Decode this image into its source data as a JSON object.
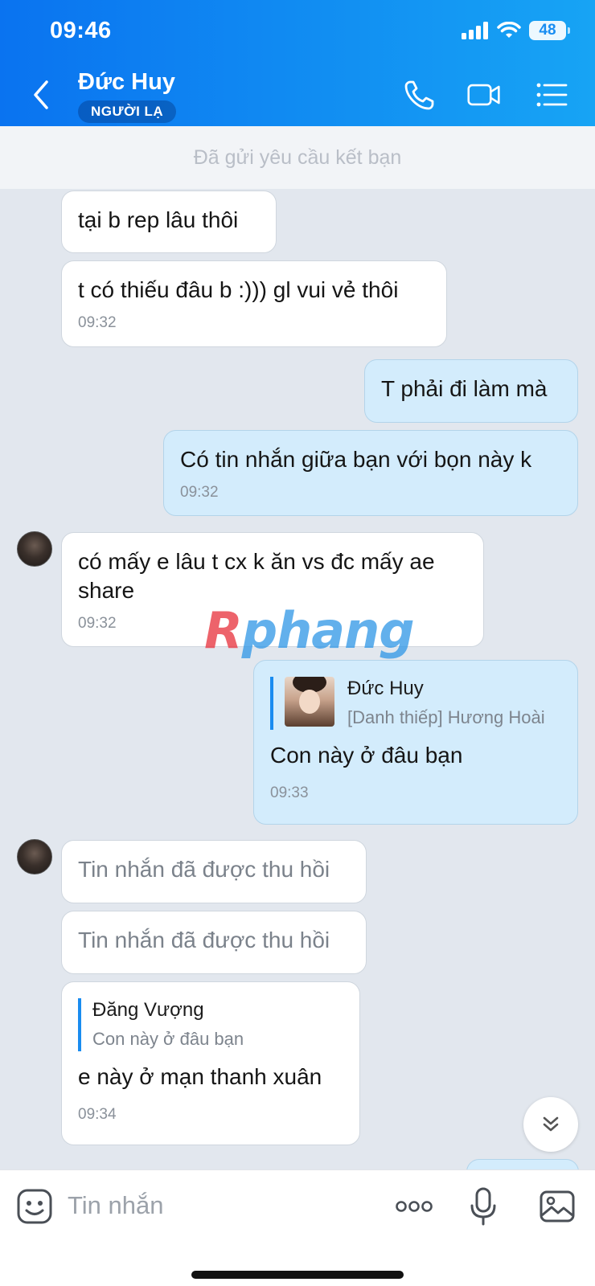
{
  "status_bar": {
    "time": "09:46",
    "battery": "48"
  },
  "header": {
    "contact_name": "Đức Huy",
    "badge": "NGƯỜI LẠ"
  },
  "friend_request_notice": "Đã gửi yêu cầu kết bạn",
  "messages": [
    {
      "text": "tại b rep lâu thôi"
    },
    {
      "text": "t có thiếu đâu b :))) gl vui vẻ thôi",
      "time": "09:32"
    },
    {
      "text": "T phải đi làm mà"
    },
    {
      "text": "Có tin nhắn giữa bạn với bọn này k",
      "time": "09:32"
    },
    {
      "text": "có mấy e lâu t cx k ăn vs đc mấy ae share",
      "time": "09:32"
    },
    {
      "quote_name": "Đức Huy",
      "quote_text": "[Danh thiếp] Hương Hoài",
      "text": "Con này ở đâu bạn",
      "time": "09:33"
    },
    {
      "text": "Tin nhắn đã được thu hồi"
    },
    {
      "text": "Tin nhắn đã được thu hồi"
    },
    {
      "quote_name": "Đăng Vượng",
      "quote_text": "Con này ở đâu bạn",
      "text": "e này ở mạn thanh xuân",
      "time": "09:34"
    }
  ],
  "watermark": {
    "first": "R",
    "rest": "phang"
  },
  "input": {
    "placeholder": "Tin nhắn"
  }
}
